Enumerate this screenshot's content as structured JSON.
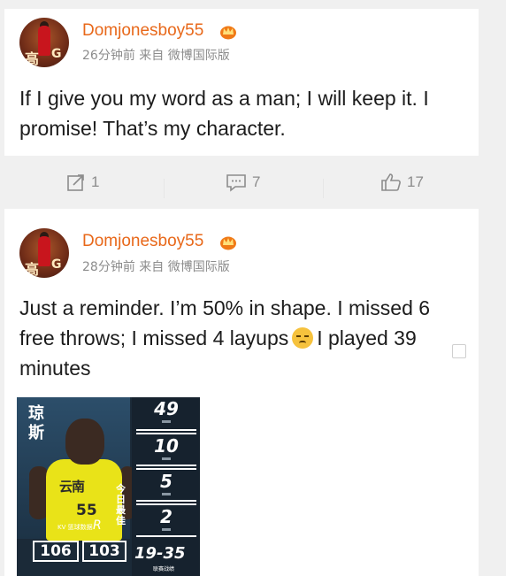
{
  "posts": [
    {
      "username": "Domjonesboy55",
      "meta": "26分钟前 来自 微博国际版",
      "text": "If I give you my word as a man; I will keep it. I promise! That’s my character.",
      "actions": {
        "repost_count": "1",
        "comment_count": "7",
        "like_count": "17"
      }
    },
    {
      "username": "Domjonesboy55",
      "meta": "28分钟前 来自 微博国际版",
      "text_line1": "Just a reminder. I’m 50% in shape. I missed 6",
      "text_line2a": "free throws; I missed 4 layups",
      "text_line2b": "I played 39",
      "text_line3": "minutes"
    }
  ],
  "avatar_text": {
    "left": "高",
    "right": "G"
  },
  "poster": {
    "player_name": "琼斯",
    "today_label": "今日最佳",
    "jersey_number": "55",
    "jersey_team": "云南",
    "stats": [
      "49",
      "10",
      "5",
      "2"
    ],
    "brand_text": "KV 篮球数据",
    "brand_logo": "R",
    "score_home": "106",
    "score_away": "103",
    "record": "19-35",
    "record_sub": "联赛战绩"
  },
  "icons": {
    "vip": "vip-crown-icon",
    "repost": "repost-icon",
    "comment": "comment-icon",
    "like": "thumbs-up-icon"
  },
  "colors": {
    "username": "#e8681a",
    "meta": "#8c8c8c",
    "text": "#1c1c1c",
    "background": "#f0f0f0"
  }
}
